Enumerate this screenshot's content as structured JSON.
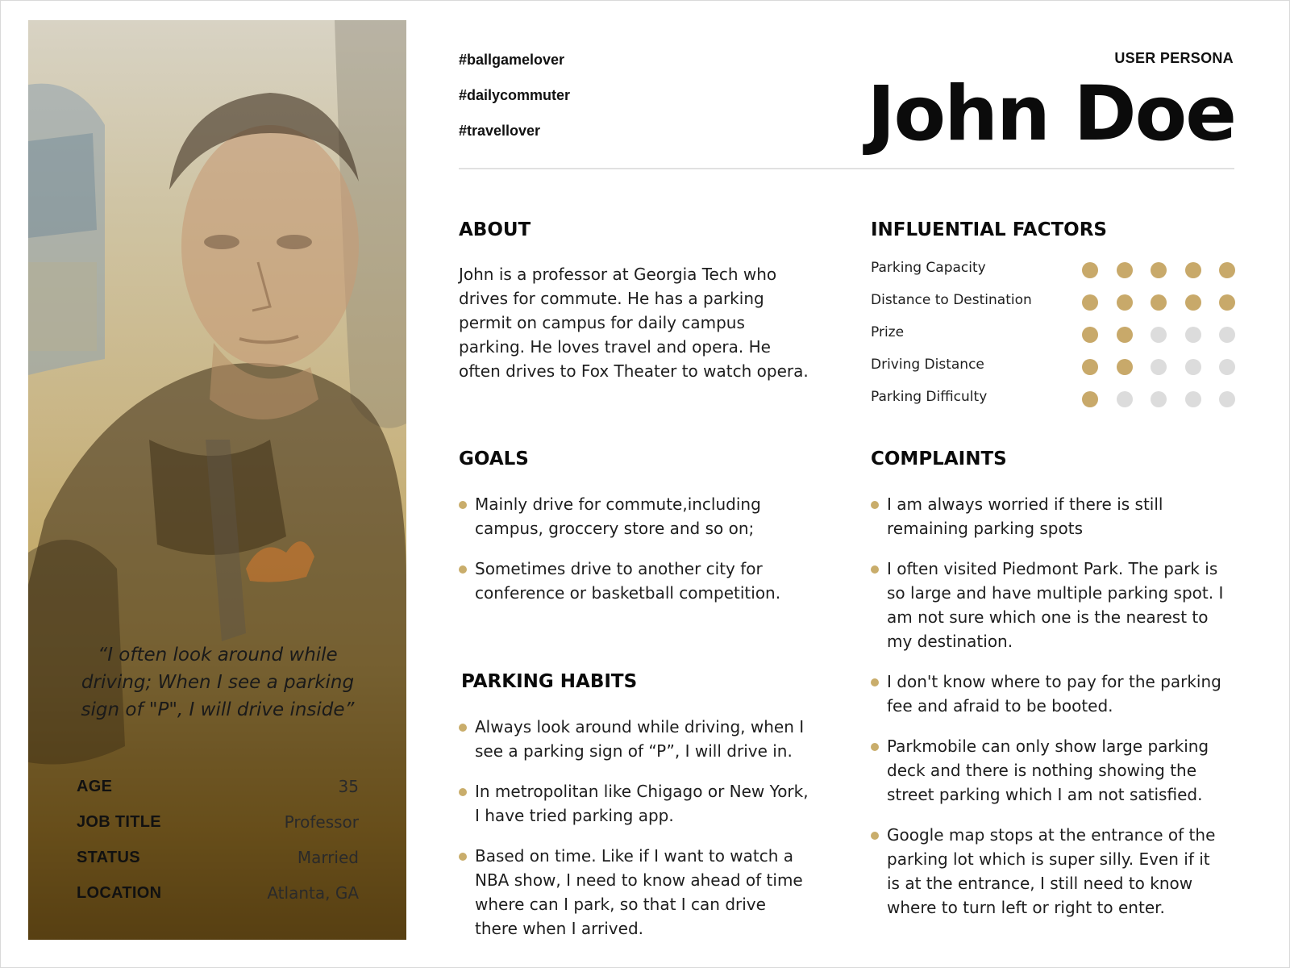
{
  "header": {
    "label": "USER PERSONA",
    "name": "John Doe",
    "hashtags": [
      "#ballgamelover",
      "#dailycommuter",
      "#travellover"
    ]
  },
  "profile": {
    "quote": "“I often look around while driving; When I see a parking sign of \"P\", I will drive inside”",
    "facts": [
      {
        "label": "AGE",
        "value": "35"
      },
      {
        "label": "JOB TITLE",
        "value": "Professor"
      },
      {
        "label": "STATUS",
        "value": "Married"
      },
      {
        "label": "LOCATION",
        "value": "Atlanta, GA"
      }
    ]
  },
  "about": {
    "title": "ABOUT",
    "text": "John is a professor at Georgia Tech who drives for commute. He has a parking permit on campus for daily campus parking. He loves travel and opera. He often drives to Fox Theater to watch opera."
  },
  "goals": {
    "title": "GOALS",
    "items": [
      "Mainly drive for commute,including campus, groccery store and so on;",
      "Sometimes drive to another city for conference or basketball competition."
    ]
  },
  "habits": {
    "title": "PARKING HABITS",
    "items": [
      "Always look around while driving, when I see a parking sign of “P”, I will drive in.",
      " In metropolitan like Chigago or New York, I have tried parking app.",
      "Based on time. Like if I want to watch a NBA show, I need to know ahead of time where can I park, so that I can drive there when I arrived."
    ]
  },
  "factors": {
    "title": "INFLUENTIAL FACTORS",
    "scale_max": 5,
    "items": [
      {
        "label": "Parking Capacity",
        "rating": 5
      },
      {
        "label": "Distance to Destination",
        "rating": 5
      },
      {
        "label": "Prize",
        "rating": 2
      },
      {
        "label": "Driving Distance",
        "rating": 2
      },
      {
        "label": "Parking Difficulty",
        "rating": 1
      }
    ],
    "colors": {
      "filled": "#c8a96a",
      "empty": "#dcdcdc"
    }
  },
  "complaints": {
    "title": "COMPLAINTS",
    "items": [
      "I am always worried if there is still remaining parking spots",
      "I often visited Piedmont Park.  The park is so large and have multiple parking spot. I am not sure which one is the nearest to my destination.",
      "I don't know where to pay for the parking fee and afraid to be booted.",
      " Parkmobile can only show large parking deck and there is nothing showing the street parking which I am not satisfied.",
      " Google map stops at the entrance of the parking lot which is super silly. Even if it is at the entrance, I still need to know where to turn left or right to enter."
    ]
  },
  "colors": {
    "accent": "#c9ad6b",
    "rule": "#e1e1e1"
  }
}
